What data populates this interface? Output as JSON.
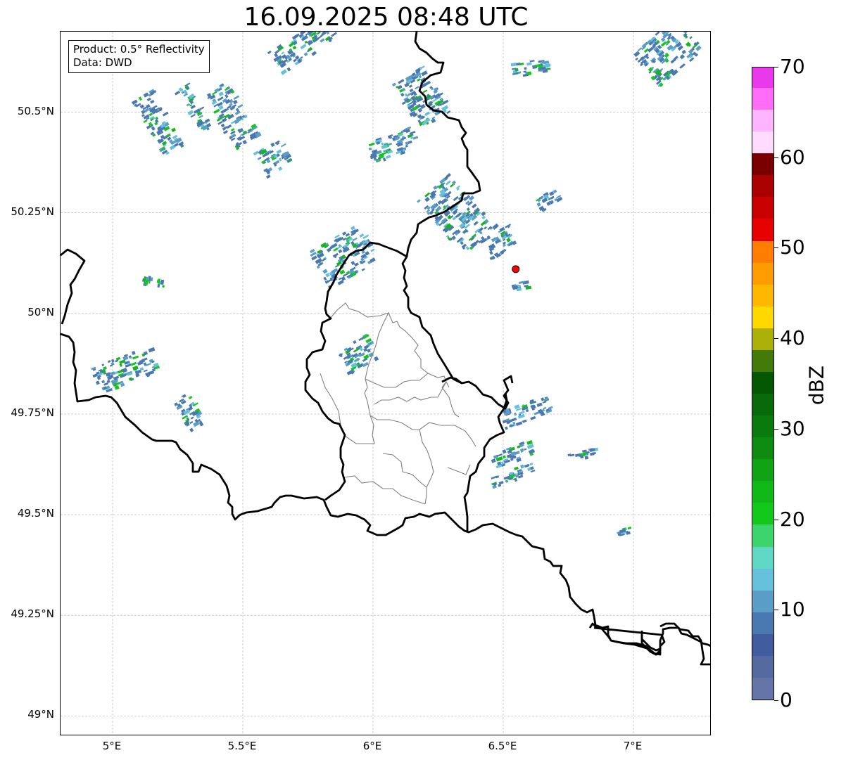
{
  "title": "16.09.2025 08:48 UTC",
  "info": {
    "product": "Product: 0.5° Reflectivity",
    "source": "Data: DWD"
  },
  "lat_ticks": [
    {
      "label": "50.5°N",
      "value": 50.5
    },
    {
      "label": "50.25°N",
      "value": 50.25
    },
    {
      "label": "50°N",
      "value": 50.0
    },
    {
      "label": "49.75°N",
      "value": 49.75
    },
    {
      "label": "49.5°N",
      "value": 49.5
    },
    {
      "label": "49.25°N",
      "value": 49.25
    },
    {
      "label": "49°N",
      "value": 49.0
    }
  ],
  "lon_ticks": [
    {
      "label": "5°E",
      "value": 5.0
    },
    {
      "label": "5.5°E",
      "value": 5.5
    },
    {
      "label": "6°E",
      "value": 6.0
    },
    {
      "label": "6.5°E",
      "value": 6.5
    },
    {
      "label": "7°E",
      "value": 7.0
    }
  ],
  "extent": {
    "lon_min": 4.8,
    "lon_max": 7.3,
    "lat_min": 48.95,
    "lat_max": 50.7
  },
  "radar_site": {
    "lon": 6.548,
    "lat": 50.11,
    "color": "#ff0000"
  },
  "colorbar": {
    "unit": "dBZ",
    "min": 0,
    "max": 70,
    "tick_values": [
      0,
      10,
      20,
      30,
      40,
      50,
      60,
      70
    ],
    "tick_labels": [
      "0",
      "10",
      "20",
      "30",
      "40",
      "50",
      "60",
      "70"
    ],
    "colors": [
      "#6675a8",
      "#5369a0",
      "#415da0",
      "#4a78b0",
      "#5a9ec8",
      "#65c0dc",
      "#5ed8c4",
      "#3cd46c",
      "#12c81a",
      "#10b818",
      "#10a414",
      "#0d8c10",
      "#0a7a0c",
      "#086a08",
      "#045804",
      "#437a0a",
      "#acb009",
      "#ffd800",
      "#ffb800",
      "#ff9c00",
      "#ff7d00",
      "#e60000",
      "#c80000",
      "#aa0000",
      "#7a0000",
      "#ffdcff",
      "#ffb4ff",
      "#ff6cf8",
      "#ea38ec"
    ]
  },
  "legend_colors": {
    "boundary": "#000000",
    "district": "#808080",
    "grid": "#b0b0b0"
  }
}
